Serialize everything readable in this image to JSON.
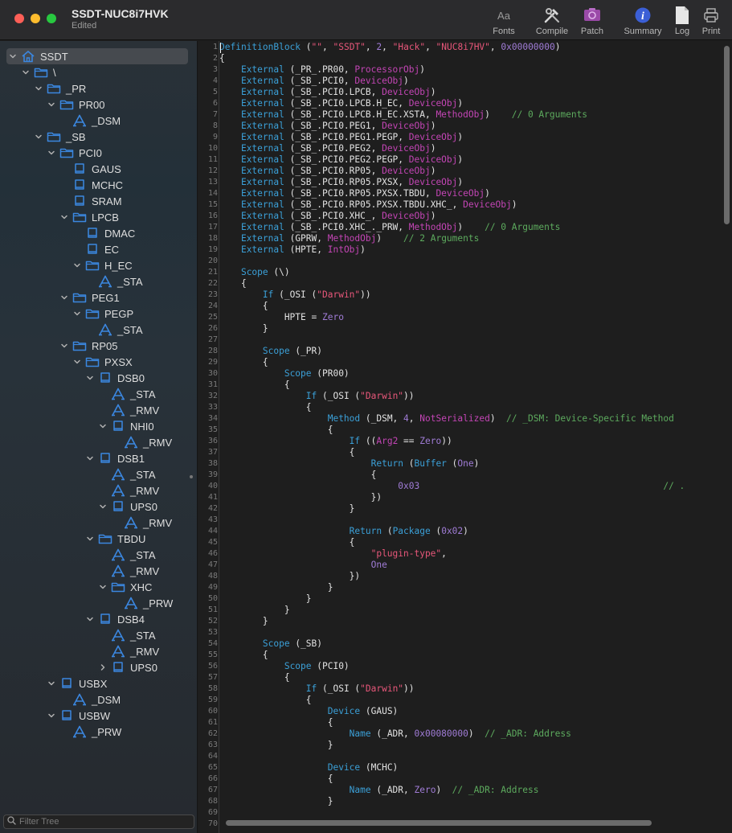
{
  "window": {
    "title": "SSDT-NUC8i7HVK",
    "subtitle": "Edited"
  },
  "toolbar": [
    {
      "label": "Fonts",
      "icon": "fonts-icon"
    },
    {
      "label": "Compile",
      "icon": "compile-icon"
    },
    {
      "label": "Patch",
      "icon": "patch-icon"
    },
    {
      "label": "Summary",
      "icon": "info-icon"
    },
    {
      "label": "Log",
      "icon": "log-icon"
    },
    {
      "label": "Print",
      "icon": "print-icon"
    }
  ],
  "colors": {
    "keyword": "#3ba0d8",
    "string": "#e8577a",
    "number": "#a07cd6",
    "type": "#c345b5",
    "comment": "#5dab5e",
    "accent": "#3b87e0"
  },
  "tree": [
    {
      "label": "SSDT",
      "icon": "home",
      "depth": 0,
      "chevron": "down",
      "selected": true
    },
    {
      "label": "\\",
      "icon": "folder",
      "depth": 1,
      "chevron": "down"
    },
    {
      "label": "_PR",
      "icon": "folder",
      "depth": 2,
      "chevron": "down"
    },
    {
      "label": "PR00",
      "icon": "folder",
      "depth": 3,
      "chevron": "down"
    },
    {
      "label": "_DSM",
      "icon": "method",
      "depth": 4,
      "chevron": ""
    },
    {
      "label": "_SB",
      "icon": "folder",
      "depth": 2,
      "chevron": "down"
    },
    {
      "label": "PCI0",
      "icon": "folder",
      "depth": 3,
      "chevron": "down"
    },
    {
      "label": "GAUS",
      "icon": "device",
      "depth": 4,
      "chevron": ""
    },
    {
      "label": "MCHC",
      "icon": "device",
      "depth": 4,
      "chevron": ""
    },
    {
      "label": "SRAM",
      "icon": "device",
      "depth": 4,
      "chevron": ""
    },
    {
      "label": "LPCB",
      "icon": "folder",
      "depth": 4,
      "chevron": "down"
    },
    {
      "label": "DMAC",
      "icon": "device",
      "depth": 5,
      "chevron": ""
    },
    {
      "label": "EC",
      "icon": "device",
      "depth": 5,
      "chevron": ""
    },
    {
      "label": "H_EC",
      "icon": "folder",
      "depth": 5,
      "chevron": "down"
    },
    {
      "label": "_STA",
      "icon": "method",
      "depth": 6,
      "chevron": ""
    },
    {
      "label": "PEG1",
      "icon": "folder",
      "depth": 4,
      "chevron": "down"
    },
    {
      "label": "PEGP",
      "icon": "folder",
      "depth": 5,
      "chevron": "down"
    },
    {
      "label": "_STA",
      "icon": "method",
      "depth": 6,
      "chevron": ""
    },
    {
      "label": "RP05",
      "icon": "folder",
      "depth": 4,
      "chevron": "down"
    },
    {
      "label": "PXSX",
      "icon": "folder",
      "depth": 5,
      "chevron": "down"
    },
    {
      "label": "DSB0",
      "icon": "device",
      "depth": 6,
      "chevron": "down"
    },
    {
      "label": "_STA",
      "icon": "method",
      "depth": 7,
      "chevron": ""
    },
    {
      "label": "_RMV",
      "icon": "method",
      "depth": 7,
      "chevron": ""
    },
    {
      "label": "NHI0",
      "icon": "device",
      "depth": 7,
      "chevron": "down"
    },
    {
      "label": "_RMV",
      "icon": "method",
      "depth": 8,
      "chevron": ""
    },
    {
      "label": "DSB1",
      "icon": "device",
      "depth": 6,
      "chevron": "down"
    },
    {
      "label": "_STA",
      "icon": "method",
      "depth": 7,
      "chevron": ""
    },
    {
      "label": "_RMV",
      "icon": "method",
      "depth": 7,
      "chevron": ""
    },
    {
      "label": "UPS0",
      "icon": "device",
      "depth": 7,
      "chevron": "down"
    },
    {
      "label": "_RMV",
      "icon": "method",
      "depth": 8,
      "chevron": ""
    },
    {
      "label": "TBDU",
      "icon": "folder",
      "depth": 6,
      "chevron": "down"
    },
    {
      "label": "_STA",
      "icon": "method",
      "depth": 7,
      "chevron": ""
    },
    {
      "label": "_RMV",
      "icon": "method",
      "depth": 7,
      "chevron": ""
    },
    {
      "label": "XHC",
      "icon": "folder",
      "depth": 7,
      "chevron": "down"
    },
    {
      "label": "_PRW",
      "icon": "method",
      "depth": 8,
      "chevron": ""
    },
    {
      "label": "DSB4",
      "icon": "device",
      "depth": 6,
      "chevron": "down"
    },
    {
      "label": "_STA",
      "icon": "method",
      "depth": 7,
      "chevron": ""
    },
    {
      "label": "_RMV",
      "icon": "method",
      "depth": 7,
      "chevron": ""
    },
    {
      "label": "UPS0",
      "icon": "device",
      "depth": 7,
      "chevron": "right"
    },
    {
      "label": "USBX",
      "icon": "device",
      "depth": 3,
      "chevron": "down"
    },
    {
      "label": "_DSM",
      "icon": "method",
      "depth": 4,
      "chevron": ""
    },
    {
      "label": "USBW",
      "icon": "device",
      "depth": 3,
      "chevron": "down"
    },
    {
      "label": "_PRW",
      "icon": "method",
      "depth": 4,
      "chevron": ""
    }
  ],
  "filter": {
    "placeholder": "Filter Tree",
    "value": ""
  },
  "code": [
    [
      [
        "k",
        "DefinitionBlock"
      ],
      [
        "p",
        " ("
      ],
      [
        "s",
        "\"\""
      ],
      [
        "p",
        ", "
      ],
      [
        "s",
        "\"SSDT\""
      ],
      [
        "p",
        ", "
      ],
      [
        "n",
        "2"
      ],
      [
        "p",
        ", "
      ],
      [
        "s",
        "\"Hack\""
      ],
      [
        "p",
        ", "
      ],
      [
        "s",
        "\"NUC8i7HV\""
      ],
      [
        "p",
        ", "
      ],
      [
        "n",
        "0x00000000"
      ],
      [
        "p",
        ")"
      ]
    ],
    [
      [
        "p",
        "{"
      ]
    ],
    [
      [
        "p",
        "    "
      ],
      [
        "k",
        "External"
      ],
      [
        "p",
        " (_PR_.PR00, "
      ],
      [
        "t",
        "ProcessorObj"
      ],
      [
        "p",
        ")"
      ]
    ],
    [
      [
        "p",
        "    "
      ],
      [
        "k",
        "External"
      ],
      [
        "p",
        " (_SB_.PCI0, "
      ],
      [
        "t",
        "DeviceObj"
      ],
      [
        "p",
        ")"
      ]
    ],
    [
      [
        "p",
        "    "
      ],
      [
        "k",
        "External"
      ],
      [
        "p",
        " (_SB_.PCI0.LPCB, "
      ],
      [
        "t",
        "DeviceObj"
      ],
      [
        "p",
        ")"
      ]
    ],
    [
      [
        "p",
        "    "
      ],
      [
        "k",
        "External"
      ],
      [
        "p",
        " (_SB_.PCI0.LPCB.H_EC, "
      ],
      [
        "t",
        "DeviceObj"
      ],
      [
        "p",
        ")"
      ]
    ],
    [
      [
        "p",
        "    "
      ],
      [
        "k",
        "External"
      ],
      [
        "p",
        " (_SB_.PCI0.LPCB.H_EC.XSTA, "
      ],
      [
        "t",
        "MethodObj"
      ],
      [
        "p",
        ")    "
      ],
      [
        "c",
        "// 0 Arguments"
      ]
    ],
    [
      [
        "p",
        "    "
      ],
      [
        "k",
        "External"
      ],
      [
        "p",
        " (_SB_.PCI0.PEG1, "
      ],
      [
        "t",
        "DeviceObj"
      ],
      [
        "p",
        ")"
      ]
    ],
    [
      [
        "p",
        "    "
      ],
      [
        "k",
        "External"
      ],
      [
        "p",
        " (_SB_.PCI0.PEG1.PEGP, "
      ],
      [
        "t",
        "DeviceObj"
      ],
      [
        "p",
        ")"
      ]
    ],
    [
      [
        "p",
        "    "
      ],
      [
        "k",
        "External"
      ],
      [
        "p",
        " (_SB_.PCI0.PEG2, "
      ],
      [
        "t",
        "DeviceObj"
      ],
      [
        "p",
        ")"
      ]
    ],
    [
      [
        "p",
        "    "
      ],
      [
        "k",
        "External"
      ],
      [
        "p",
        " (_SB_.PCI0.PEG2.PEGP, "
      ],
      [
        "t",
        "DeviceObj"
      ],
      [
        "p",
        ")"
      ]
    ],
    [
      [
        "p",
        "    "
      ],
      [
        "k",
        "External"
      ],
      [
        "p",
        " (_SB_.PCI0.RP05, "
      ],
      [
        "t",
        "DeviceObj"
      ],
      [
        "p",
        ")"
      ]
    ],
    [
      [
        "p",
        "    "
      ],
      [
        "k",
        "External"
      ],
      [
        "p",
        " (_SB_.PCI0.RP05.PXSX, "
      ],
      [
        "t",
        "DeviceObj"
      ],
      [
        "p",
        ")"
      ]
    ],
    [
      [
        "p",
        "    "
      ],
      [
        "k",
        "External"
      ],
      [
        "p",
        " (_SB_.PCI0.RP05.PXSX.TBDU, "
      ],
      [
        "t",
        "DeviceObj"
      ],
      [
        "p",
        ")"
      ]
    ],
    [
      [
        "p",
        "    "
      ],
      [
        "k",
        "External"
      ],
      [
        "p",
        " (_SB_.PCI0.RP05.PXSX.TBDU.XHC_, "
      ],
      [
        "t",
        "DeviceObj"
      ],
      [
        "p",
        ")"
      ]
    ],
    [
      [
        "p",
        "    "
      ],
      [
        "k",
        "External"
      ],
      [
        "p",
        " (_SB_.PCI0.XHC_, "
      ],
      [
        "t",
        "DeviceObj"
      ],
      [
        "p",
        ")"
      ]
    ],
    [
      [
        "p",
        "    "
      ],
      [
        "k",
        "External"
      ],
      [
        "p",
        " (_SB_.PCI0.XHC_._PRW, "
      ],
      [
        "t",
        "MethodObj"
      ],
      [
        "p",
        ")    "
      ],
      [
        "c",
        "// 0 Arguments"
      ]
    ],
    [
      [
        "p",
        "    "
      ],
      [
        "k",
        "External"
      ],
      [
        "p",
        " (GPRW, "
      ],
      [
        "t",
        "MethodObj"
      ],
      [
        "p",
        ")    "
      ],
      [
        "c",
        "// 2 Arguments"
      ]
    ],
    [
      [
        "p",
        "    "
      ],
      [
        "k",
        "External"
      ],
      [
        "p",
        " (HPTE, "
      ],
      [
        "t",
        "IntObj"
      ],
      [
        "p",
        ")"
      ]
    ],
    [],
    [
      [
        "p",
        "    "
      ],
      [
        "k",
        "Scope"
      ],
      [
        "p",
        " (\\)"
      ]
    ],
    [
      [
        "p",
        "    {"
      ]
    ],
    [
      [
        "p",
        "        "
      ],
      [
        "k",
        "If"
      ],
      [
        "p",
        " (_OSI ("
      ],
      [
        "s",
        "\"Darwin\""
      ],
      [
        "p",
        "))"
      ]
    ],
    [
      [
        "p",
        "        {"
      ]
    ],
    [
      [
        "p",
        "            HPTE = "
      ],
      [
        "n",
        "Zero"
      ]
    ],
    [
      [
        "p",
        "        }"
      ]
    ],
    [],
    [
      [
        "p",
        "        "
      ],
      [
        "k",
        "Scope"
      ],
      [
        "p",
        " (_PR)"
      ]
    ],
    [
      [
        "p",
        "        {"
      ]
    ],
    [
      [
        "p",
        "            "
      ],
      [
        "k",
        "Scope"
      ],
      [
        "p",
        " (PR00)"
      ]
    ],
    [
      [
        "p",
        "            {"
      ]
    ],
    [
      [
        "p",
        "                "
      ],
      [
        "k",
        "If"
      ],
      [
        "p",
        " (_OSI ("
      ],
      [
        "s",
        "\"Darwin\""
      ],
      [
        "p",
        "))"
      ]
    ],
    [
      [
        "p",
        "                {"
      ]
    ],
    [
      [
        "p",
        "                    "
      ],
      [
        "k",
        "Method"
      ],
      [
        "p",
        " (_DSM, "
      ],
      [
        "n",
        "4"
      ],
      [
        "p",
        ", "
      ],
      [
        "t",
        "NotSerialized"
      ],
      [
        "p",
        ")  "
      ],
      [
        "c",
        "// _DSM: Device-Specific Method"
      ]
    ],
    [
      [
        "p",
        "                    {"
      ]
    ],
    [
      [
        "p",
        "                        "
      ],
      [
        "k",
        "If"
      ],
      [
        "p",
        " (("
      ],
      [
        "t",
        "Arg2"
      ],
      [
        "p",
        " == "
      ],
      [
        "n",
        "Zero"
      ],
      [
        "p",
        "))"
      ]
    ],
    [
      [
        "p",
        "                        {"
      ]
    ],
    [
      [
        "p",
        "                            "
      ],
      [
        "k",
        "Return"
      ],
      [
        "p",
        " ("
      ],
      [
        "k",
        "Buffer"
      ],
      [
        "p",
        " ("
      ],
      [
        "n",
        "One"
      ],
      [
        "p",
        ")"
      ]
    ],
    [
      [
        "p",
        "                            {"
      ]
    ],
    [
      [
        "p",
        "                                 "
      ],
      [
        "n",
        "0x03"
      ],
      [
        "p",
        "                                             "
      ],
      [
        "c",
        "// ."
      ]
    ],
    [
      [
        "p",
        "                            })"
      ]
    ],
    [
      [
        "p",
        "                        }"
      ]
    ],
    [],
    [
      [
        "p",
        "                        "
      ],
      [
        "k",
        "Return"
      ],
      [
        "p",
        " ("
      ],
      [
        "k",
        "Package"
      ],
      [
        "p",
        " ("
      ],
      [
        "n",
        "0x02"
      ],
      [
        "p",
        ")"
      ]
    ],
    [
      [
        "p",
        "                        {"
      ]
    ],
    [
      [
        "p",
        "                            "
      ],
      [
        "s",
        "\"plugin-type\""
      ],
      [
        "p",
        ","
      ]
    ],
    [
      [
        "p",
        "                            "
      ],
      [
        "n",
        "One"
      ]
    ],
    [
      [
        "p",
        "                        })"
      ]
    ],
    [
      [
        "p",
        "                    }"
      ]
    ],
    [
      [
        "p",
        "                }"
      ]
    ],
    [
      [
        "p",
        "            }"
      ]
    ],
    [
      [
        "p",
        "        }"
      ]
    ],
    [],
    [
      [
        "p",
        "        "
      ],
      [
        "k",
        "Scope"
      ],
      [
        "p",
        " (_SB)"
      ]
    ],
    [
      [
        "p",
        "        {"
      ]
    ],
    [
      [
        "p",
        "            "
      ],
      [
        "k",
        "Scope"
      ],
      [
        "p",
        " (PCI0)"
      ]
    ],
    [
      [
        "p",
        "            {"
      ]
    ],
    [
      [
        "p",
        "                "
      ],
      [
        "k",
        "If"
      ],
      [
        "p",
        " (_OSI ("
      ],
      [
        "s",
        "\"Darwin\""
      ],
      [
        "p",
        "))"
      ]
    ],
    [
      [
        "p",
        "                {"
      ]
    ],
    [
      [
        "p",
        "                    "
      ],
      [
        "k",
        "Device"
      ],
      [
        "p",
        " (GAUS)"
      ]
    ],
    [
      [
        "p",
        "                    {"
      ]
    ],
    [
      [
        "p",
        "                        "
      ],
      [
        "k",
        "Name"
      ],
      [
        "p",
        " (_ADR, "
      ],
      [
        "n",
        "0x00080000"
      ],
      [
        "p",
        ")  "
      ],
      [
        "c",
        "// _ADR: Address"
      ]
    ],
    [
      [
        "p",
        "                    }"
      ]
    ],
    [],
    [
      [
        "p",
        "                    "
      ],
      [
        "k",
        "Device"
      ],
      [
        "p",
        " (MCHC)"
      ]
    ],
    [
      [
        "p",
        "                    {"
      ]
    ],
    [
      [
        "p",
        "                        "
      ],
      [
        "k",
        "Name"
      ],
      [
        "p",
        " (_ADR, "
      ],
      [
        "n",
        "Zero"
      ],
      [
        "p",
        ")  "
      ],
      [
        "c",
        "// _ADR: Address"
      ]
    ],
    [
      [
        "p",
        "                    }"
      ]
    ],
    [],
    []
  ]
}
